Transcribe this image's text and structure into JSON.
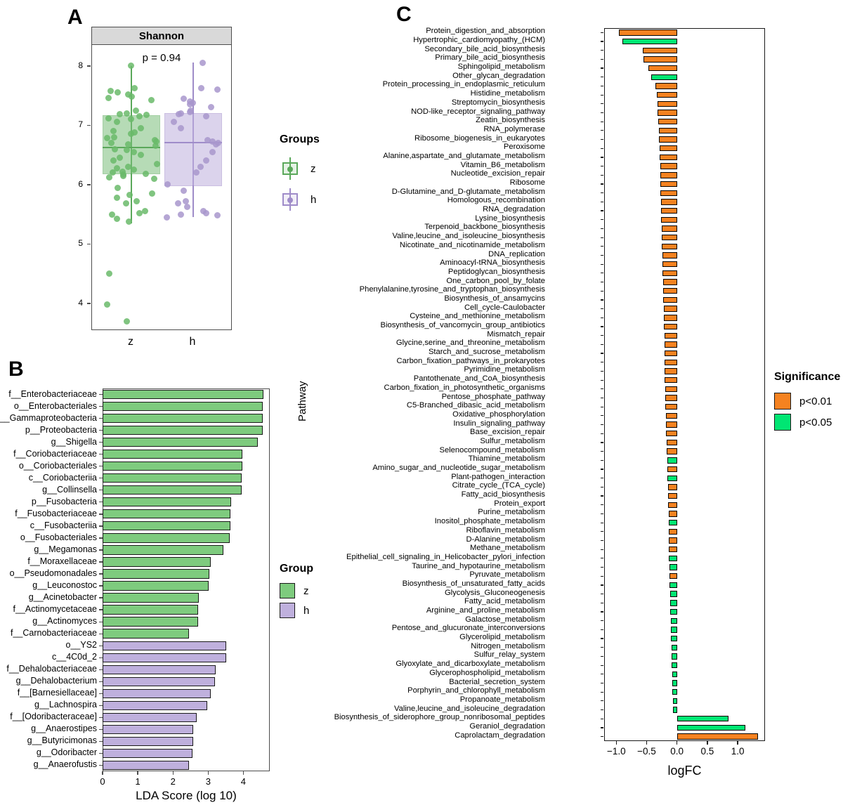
{
  "figure": {
    "panels": [
      {
        "letter": "A"
      },
      {
        "letter": "B"
      },
      {
        "letter": "C"
      }
    ]
  },
  "panelA": {
    "letter": "A",
    "strip_title": "Shannon",
    "pvalue_text": "p = 0.94",
    "y_ticks": [
      "8",
      "7",
      "6",
      "5",
      "4"
    ],
    "x_ticks": [
      "z",
      "h"
    ],
    "legend": {
      "title": "Groups",
      "items": [
        {
          "label": "z",
          "color": "#7bbf7b"
        },
        {
          "label": "h",
          "color": "#bfb0dd"
        }
      ]
    },
    "chart_data": {
      "type": "box",
      "title": "Shannon",
      "xlabel": "",
      "ylabel": "",
      "ylim": [
        3.55,
        8.35
      ],
      "annotation": "p = 0.94",
      "categories": [
        "z",
        "h"
      ],
      "boxes": [
        {
          "group": "z",
          "color": "#7bbf7b",
          "min": 5.35,
          "q1": 6.17,
          "median": 6.62,
          "q3": 7.17,
          "max": 8.0
        },
        {
          "group": "h",
          "color": "#bfb0dd",
          "min": 5.45,
          "q1": 5.97,
          "median": 6.71,
          "q3": 7.2,
          "max": 8.05
        }
      ],
      "points": {
        "z": [
          8.0,
          7.62,
          7.58,
          7.55,
          7.52,
          7.48,
          7.46,
          7.42,
          7.25,
          7.2,
          7.18,
          7.17,
          7.15,
          7.12,
          7.1,
          7.05,
          6.95,
          6.9,
          6.88,
          6.85,
          6.8,
          6.78,
          6.75,
          6.72,
          6.7,
          6.68,
          6.65,
          6.6,
          6.58,
          6.55,
          6.5,
          6.45,
          6.4,
          6.35,
          6.3,
          6.28,
          6.25,
          6.22,
          6.2,
          6.18,
          6.17,
          6.15,
          6.12,
          6.1,
          5.95,
          5.85,
          5.82,
          5.78,
          5.72,
          5.68,
          5.55,
          5.52,
          5.5,
          5.42,
          5.38,
          4.5,
          3.98,
          3.7
        ],
        "h": [
          8.05,
          7.62,
          7.6,
          7.45,
          7.4,
          7.38,
          7.35,
          7.3,
          7.25,
          7.22,
          7.2,
          7.18,
          7.15,
          7.05,
          6.95,
          6.75,
          6.72,
          6.7,
          6.68,
          6.55,
          6.4,
          6.3,
          6.2,
          6.0,
          5.9,
          5.72,
          5.68,
          5.62,
          5.55,
          5.52,
          5.5,
          5.48,
          5.45
        ]
      }
    }
  },
  "panelB": {
    "letter": "B",
    "x_title": "LDA Score (log 10)",
    "x_ticks": [
      "0",
      "1",
      "2",
      "3",
      "4"
    ],
    "legend": {
      "title": "Group",
      "items": [
        {
          "label": "z",
          "color": "#7ecb7e"
        },
        {
          "label": "h",
          "color": "#bfb0dd"
        }
      ]
    },
    "chart_data": {
      "type": "bar",
      "orientation": "horizontal",
      "title": "",
      "xlabel": "LDA Score (log 10)",
      "ylabel": "",
      "xlim": [
        0,
        4.75
      ],
      "legend_title": "Group",
      "series": [
        {
          "name": "z",
          "color": "#7ecb7e"
        },
        {
          "name": "h",
          "color": "#bfb0dd"
        }
      ],
      "categories": [
        "f__Enterobacteriaceae",
        "o__Enterobacteriales",
        "c__Gammaproteobacteria",
        "p__Proteobacteria",
        "g__Shigella",
        "f__Coriobacteriaceae",
        "o__Coriobacteriales",
        "c__Coriobacteriia",
        "g__Collinsella",
        "p__Fusobacteria",
        "f__Fusobacteriaceae",
        "c__Fusobacteriia",
        "o__Fusobacteriales",
        "g__Megamonas",
        "f__Moraxellaceae",
        "o__Pseudomonadales",
        "g__Leuconostoc",
        "g__Acinetobacter",
        "f__Actinomycetaceae",
        "g__Actinomyces",
        "f__Carnobacteriaceae",
        "o__YS2",
        "c__4C0d_2",
        "f__Dehalobacteriaceae",
        "g__Dehalobacterium",
        "f__[Barnesiellaceae]",
        "g__Lachnospira",
        "f__[Odoribacteraceae]",
        "g__Anaerostipes",
        "g__Butyricimonas",
        "g__Odoribacter",
        "g__Anaerofustis"
      ],
      "values": [
        4.58,
        4.56,
        4.56,
        4.55,
        4.42,
        3.98,
        3.97,
        3.96,
        3.95,
        3.66,
        3.64,
        3.63,
        3.62,
        3.43,
        3.08,
        3.03,
        3.02,
        2.73,
        2.72,
        2.71,
        2.45,
        3.52,
        3.51,
        3.22,
        3.2,
        3.08,
        2.98,
        2.67,
        2.58,
        2.57,
        2.56,
        2.45
      ],
      "group_of_value": [
        "z",
        "z",
        "z",
        "z",
        "z",
        "z",
        "z",
        "z",
        "z",
        "z",
        "z",
        "z",
        "z",
        "z",
        "z",
        "z",
        "z",
        "z",
        "z",
        "z",
        "z",
        "h",
        "h",
        "h",
        "h",
        "h",
        "h",
        "h",
        "h",
        "h",
        "h",
        "h"
      ]
    }
  },
  "panelC": {
    "letter": "C",
    "x_title": "logFC",
    "y_title": "Pathway",
    "x_ticks": [
      "-1.0",
      "-0.5",
      "0.0",
      "0.5",
      "1.0"
    ],
    "legend": {
      "title": "Significance",
      "items": [
        {
          "label": "p<0.01",
          "color": "#f58220"
        },
        {
          "label": "p<0.05",
          "color": "#00e673"
        }
      ]
    },
    "chart_data": {
      "type": "bar",
      "orientation": "horizontal",
      "title": "",
      "xlabel": "logFC",
      "ylabel": "Pathway",
      "xlim": [
        -1.2,
        1.45
      ],
      "legend_title": "Significance",
      "legend_entries": [
        {
          "name": "p<0.01",
          "color": "#f58220"
        },
        {
          "name": "p<0.05",
          "color": "#00e673"
        }
      ],
      "categories": [
        "Protein_digestion_and_absorption",
        "Hypertrophic_cardiomyopathy_(HCM)",
        "Secondary_bile_acid_biosynthesis",
        "Primary_bile_acid_biosynthesis",
        "Sphingolipid_metabolism",
        "Other_glycan_degradation",
        "Protein_processing_in_endoplasmic_reticulum",
        "Histidine_metabolism",
        "Streptomycin_biosynthesis",
        "NOD-like_receptor_signaling_pathway",
        "Zeatin_biosynthesis",
        "RNA_polymerase",
        "Ribosome_biogenesis_in_eukaryotes",
        "Peroxisome",
        "Alanine,aspartate_and_glutamate_metabolism",
        "Vitamin_B6_metabolism",
        "Nucleotide_excision_repair",
        "Ribosome",
        "D-Glutamine_and_D-glutamate_metabolism",
        "Homologous_recombination",
        "RNA_degradation",
        "Lysine_biosynthesis",
        "Terpenoid_backbone_biosynthesis",
        "Valine,leucine_and_isoleucine_biosynthesis",
        "Nicotinate_and_nicotinamide_metabolism",
        "DNA_replication",
        "Aminoacyl-tRNA_biosynthesis",
        "Peptidoglycan_biosynthesis",
        "One_carbon_pool_by_folate",
        "Phenylalanine,tyrosine_and_tryptophan_biosynthesis",
        "Biosynthesis_of_ansamycins",
        "Cell_cycle-Caulobacter",
        "Cysteine_and_methionine_metabolism",
        "Biosynthesis_of_vancomycin_group_antibiotics",
        "Mismatch_repair",
        "Glycine,serine_and_threonine_metabolism",
        "Starch_and_sucrose_metabolism",
        "Carbon_fixation_pathways_in_prokaryotes",
        "Pyrimidine_metabolism",
        "Pantothenate_and_CoA_biosynthesis",
        "Carbon_fixation_in_photosynthetic_organisms",
        "Pentose_phosphate_pathway",
        "C5-Branched_dibasic_acid_metabolism",
        "Oxidative_phosphorylation",
        "Insulin_signaling_pathway",
        "Base_excision_repair",
        "Sulfur_metabolism",
        "Selenocompound_metabolism",
        "Thiamine_metabolism",
        "Amino_sugar_and_nucleotide_sugar_metabolism",
        "Plant-pathogen_interaction",
        "Citrate_cycle_(TCA_cycle)",
        "Fatty_acid_biosynthesis",
        "Protein_export",
        "Purine_metabolism",
        "Inositol_phosphate_metabolism",
        "Riboflavin_metabolism",
        "D-Alanine_metabolism",
        "Methane_metabolism",
        "Epithelial_cell_signaling_in_Helicobacter_pylori_infection",
        "Taurine_and_hypotaurine_metabolism",
        "Pyruvate_metabolism",
        "Biosynthesis_of_unsaturated_fatty_acids",
        "Glycolysis_Gluconeogenesis",
        "Fatty_acid_metabolism",
        "Arginine_and_proline_metabolism",
        "Galactose_metabolism",
        "Pentose_and_glucuronate_interconversions",
        "Glycerolipid_metabolism",
        "Nitrogen_metabolism",
        "Sulfur_relay_system",
        "Glyoxylate_and_dicarboxylate_metabolism",
        "Glycerophospholipid_metabolism",
        "Bacterial_secretion_system",
        "Porphyrin_and_chlorophyll_metabolism",
        "Propanoate_metabolism",
        "Valine,leucine_and_isoleucine_degradation",
        "Biosynthesis_of_siderophore_group_nonribosomal_peptides",
        "Geraniol_degradation",
        "Caprolactam_degradation"
      ],
      "values": [
        -0.96,
        -0.9,
        -0.56,
        -0.55,
        -0.47,
        -0.43,
        -0.35,
        -0.33,
        -0.32,
        -0.32,
        -0.31,
        -0.3,
        -0.3,
        -0.29,
        -0.29,
        -0.28,
        -0.28,
        -0.27,
        -0.27,
        -0.26,
        -0.26,
        -0.26,
        -0.25,
        -0.25,
        -0.25,
        -0.24,
        -0.24,
        -0.24,
        -0.23,
        -0.23,
        -0.23,
        -0.22,
        -0.22,
        -0.22,
        -0.21,
        -0.21,
        -0.21,
        -0.2,
        -0.2,
        -0.2,
        -0.19,
        -0.19,
        -0.19,
        -0.18,
        -0.18,
        -0.18,
        -0.17,
        -0.17,
        -0.16,
        -0.16,
        -0.16,
        -0.15,
        -0.15,
        -0.15,
        -0.14,
        -0.14,
        -0.14,
        -0.13,
        -0.13,
        -0.13,
        -0.12,
        -0.12,
        -0.12,
        -0.11,
        -0.11,
        -0.11,
        -0.1,
        -0.1,
        -0.1,
        -0.09,
        -0.09,
        -0.09,
        -0.08,
        -0.08,
        -0.08,
        -0.07,
        -0.07,
        0.85,
        1.13,
        1.34
      ],
      "significance": [
        "p<0.01",
        "p<0.05",
        "p<0.01",
        "p<0.01",
        "p<0.01",
        "p<0.05",
        "p<0.01",
        "p<0.01",
        "p<0.01",
        "p<0.01",
        "p<0.01",
        "p<0.01",
        "p<0.01",
        "p<0.01",
        "p<0.01",
        "p<0.01",
        "p<0.01",
        "p<0.01",
        "p<0.01",
        "p<0.01",
        "p<0.01",
        "p<0.01",
        "p<0.01",
        "p<0.01",
        "p<0.01",
        "p<0.01",
        "p<0.01",
        "p<0.01",
        "p<0.01",
        "p<0.01",
        "p<0.01",
        "p<0.01",
        "p<0.01",
        "p<0.01",
        "p<0.01",
        "p<0.01",
        "p<0.01",
        "p<0.01",
        "p<0.01",
        "p<0.01",
        "p<0.01",
        "p<0.01",
        "p<0.01",
        "p<0.01",
        "p<0.01",
        "p<0.01",
        "p<0.01",
        "p<0.01",
        "p<0.05",
        "p<0.01",
        "p<0.05",
        "p<0.01",
        "p<0.01",
        "p<0.01",
        "p<0.01",
        "p<0.05",
        "p<0.01",
        "p<0.01",
        "p<0.01",
        "p<0.05",
        "p<0.05",
        "p<0.01",
        "p<0.05",
        "p<0.05",
        "p<0.05",
        "p<0.05",
        "p<0.05",
        "p<0.05",
        "p<0.05",
        "p<0.05",
        "p<0.05",
        "p<0.05",
        "p<0.05",
        "p<0.05",
        "p<0.05",
        "p<0.05",
        "p<0.05",
        "p<0.05",
        "p<0.05",
        "p<0.01"
      ]
    }
  }
}
